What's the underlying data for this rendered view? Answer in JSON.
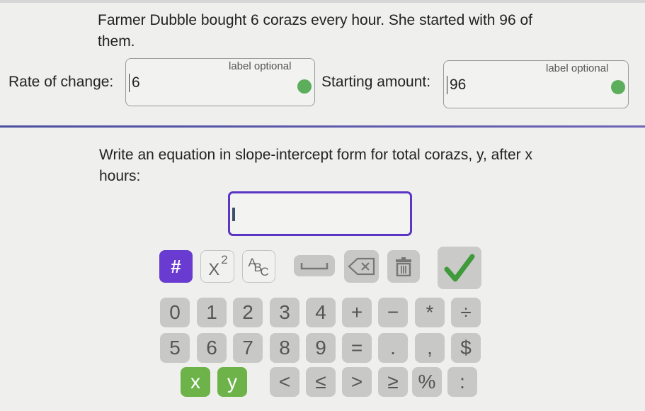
{
  "problem": {
    "text": "Farmer Dubble bought 6 corazs every hour. She started with 96 of them."
  },
  "rate_field": {
    "label": "Rate of change:",
    "optional_label": "label optional",
    "value": "6",
    "status_color": "#5cae5c"
  },
  "start_field": {
    "label": "Starting amount:",
    "optional_label": "label optional",
    "value": "96",
    "status_color": "#5cae5c"
  },
  "question": {
    "text": "Write an equation in slope-intercept form for total corazs, y, after x hours:"
  },
  "answer_input": {
    "value": ""
  },
  "toolbar": {
    "numbers_mode": "#",
    "exponent_base": "X",
    "exponent_power": "2",
    "abc_a": "A",
    "abc_b": "B",
    "abc_c": "C",
    "check": "✓"
  },
  "keypad": {
    "row1": [
      "0",
      "1",
      "2",
      "3",
      "4",
      "+",
      "−",
      "*",
      "÷"
    ],
    "row2": [
      "5",
      "6",
      "7",
      "8",
      "9",
      "=",
      ".",
      ",",
      "$"
    ],
    "row3_vars": [
      "x",
      "y"
    ],
    "row3_ops": [
      "<",
      "≤",
      ">",
      "≥",
      "%",
      ":"
    ]
  },
  "colors": {
    "accent_purple": "#5b36c2",
    "var_green": "#6db34a",
    "check_green": "#3f9a3a"
  }
}
